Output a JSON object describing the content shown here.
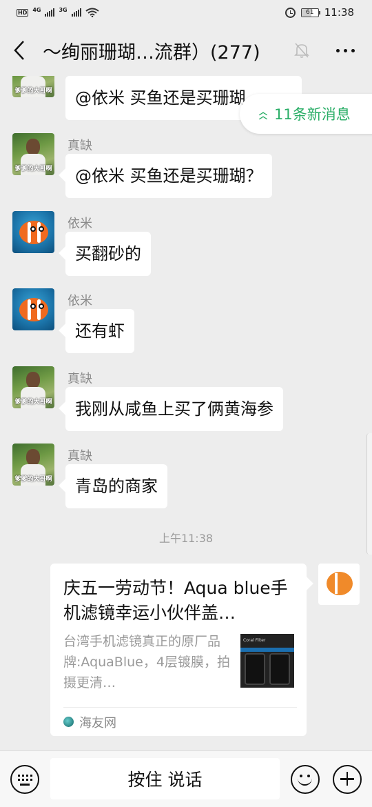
{
  "status_bar": {
    "hd_label": "HD",
    "network_1": "4G",
    "network_2": "3G",
    "battery": "61",
    "time": "11:38",
    "icons": [
      "signal-icon",
      "wifi-icon",
      "alarm-icon",
      "battery-icon"
    ]
  },
  "header": {
    "title": "～绚丽珊瑚…流群）(277)",
    "icons": [
      "back-icon",
      "mute-bell-icon",
      "more-icon"
    ]
  },
  "new_messages": {
    "label": "11条新消息",
    "icon": "double-chevron-up-icon",
    "color": "#2aae67"
  },
  "messages": [
    {
      "sender": "",
      "text": "@依米  买鱼还是买珊瑚",
      "avatar": "man"
    },
    {
      "sender": "真缺",
      "text": "@依米  买鱼还是买珊瑚？",
      "avatar": "man"
    },
    {
      "sender": "依米",
      "text": "买翻砂的",
      "avatar": "fish"
    },
    {
      "sender": "依米",
      "text": "还有虾",
      "avatar": "fish"
    },
    {
      "sender": "真缺",
      "text": "我刚从咸鱼上买了俩黄海参",
      "avatar": "man"
    },
    {
      "sender": "真缺",
      "text": "青岛的商家",
      "avatar": "man"
    }
  ],
  "avatar_caption": "爹爹的大哥啊",
  "time_divider": "上午11:38",
  "card": {
    "title": "庆五一劳动节！Aqua blue手机滤镜幸运小伙伴盖…",
    "description": "台湾手机滤镜真正的原厂品牌:AquaBlue，4层镀膜，拍摄更清…",
    "thumb_label": "Coral Filter",
    "source": "海友网"
  },
  "input_bar": {
    "hold_to_talk": "按住 说话",
    "icons": [
      "keyboard-icon",
      "emoji-icon",
      "plus-icon"
    ]
  }
}
